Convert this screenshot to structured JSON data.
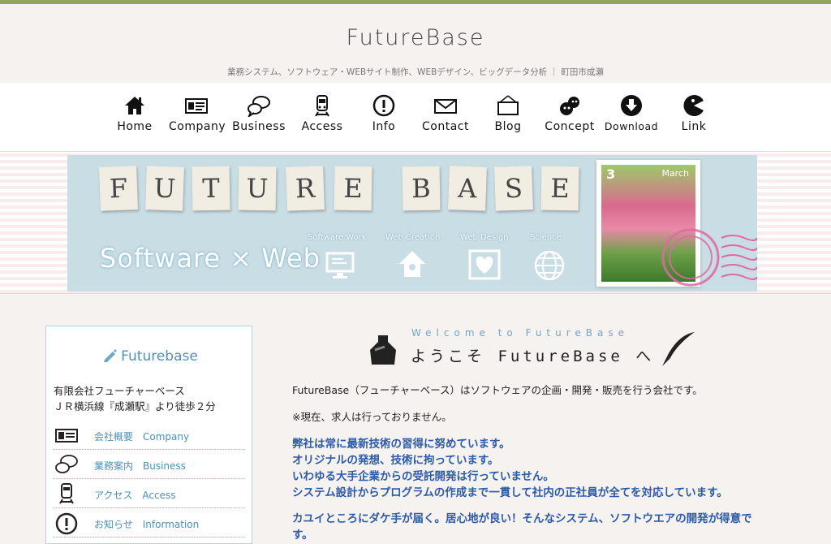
{
  "header": {
    "logo": "FutureBase",
    "tagline": "業務システム、ソフトウェア・WEBサイト制作、WEBデザイン、ビッグデータ分析 ｜ 町田市成瀬"
  },
  "nav": [
    {
      "label": "Home",
      "icon": "home-icon"
    },
    {
      "label": "Company",
      "icon": "id-card-icon"
    },
    {
      "label": "Business",
      "icon": "chat-bubbles-icon"
    },
    {
      "label": "Access",
      "icon": "train-icon"
    },
    {
      "label": "Info",
      "icon": "exclamation-icon"
    },
    {
      "label": "Contact",
      "icon": "envelope-icon"
    },
    {
      "label": "Blog",
      "icon": "signboard-icon"
    },
    {
      "label": "Concept",
      "icon": "concept-icon"
    },
    {
      "label": "Download",
      "icon": "download-icon"
    },
    {
      "label": "Link",
      "icon": "link-icon"
    }
  ],
  "banner": {
    "letters": [
      "F",
      "U",
      "T",
      "U",
      "R",
      "E",
      "B",
      "A",
      "S",
      "E"
    ],
    "software_web": "Software × Web",
    "categories": [
      "Software Work",
      "Web Creation",
      "Web Design",
      "Science"
    ],
    "stamp_number": "3",
    "stamp_month": "March"
  },
  "sidebar": {
    "title": "Futurebase",
    "company_name": "有限会社フューチャーベース",
    "access_text": "ＪＲ横浜線『成瀬駅』より徒歩２分",
    "items": [
      {
        "label": "会社概要　Company",
        "icon": "id-card-icon"
      },
      {
        "label": "業務案内　Business",
        "icon": "chat-bubbles-icon"
      },
      {
        "label": "アクセス　Access",
        "icon": "train-icon"
      },
      {
        "label": "お知らせ　Information",
        "icon": "exclamation-icon"
      }
    ]
  },
  "main": {
    "welcome_small": "Welcome to FutureBase",
    "welcome_big": "ようこそ FutureBase へ",
    "intro": "FutureBase（フューチャーベース）はソフトウェアの企画・開発・販売を行う会社です。",
    "notice": "※現在、求人は行っておりません。",
    "blue_lines": [
      "弊社は常に最新技術の習得に努めています。",
      "オリジナルの発想、技術に拘っています。",
      "いわゆる大手企業からの受託開発は行っていません。",
      "システム設計からプログラムの作成まで一貫して社内の正社員が全てを対応しています。",
      "カユイところにダケ手が届く。居心地が良い！そんなシステム、ソフトウエアの開発が得意で",
      "す。"
    ]
  },
  "colors": {
    "top_bar": "#8fa85a",
    "background": "#f6f2ef",
    "sidebar_border": "#b8d3dc",
    "link_blue": "#4a90b8",
    "text_blue": "#2b5aa8"
  }
}
